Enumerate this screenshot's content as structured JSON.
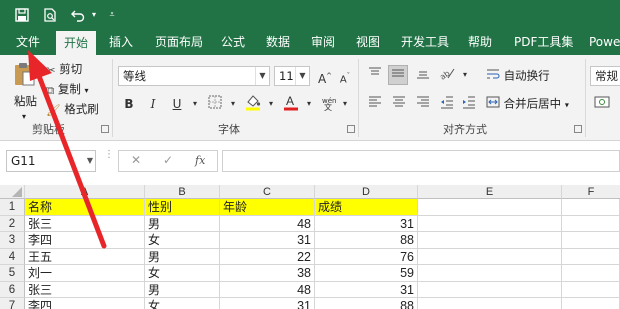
{
  "qat": {
    "icons": [
      "save-icon",
      "print-preview-icon",
      "undo-icon",
      "customize-qat-icon"
    ]
  },
  "tabs": [
    "文件",
    "开始",
    "插入",
    "页面布局",
    "公式",
    "数据",
    "审阅",
    "视图",
    "开发工具",
    "帮助",
    "PDF工具集",
    "Power"
  ],
  "active_tab": "开始",
  "clipboard": {
    "paste": "粘贴",
    "cut": "剪切",
    "copy": "复制",
    "format_painter": "格式刷",
    "group": "剪贴板"
  },
  "font": {
    "name": "等线",
    "size": "11",
    "group": "字体",
    "font_color": "#e02020",
    "fill_color": "#ffff00"
  },
  "alignment": {
    "wrap": "自动换行",
    "merge": "合并后居中",
    "group": "对齐方式"
  },
  "number": {
    "format": "常规"
  },
  "formula_bar": {
    "name_box": "G11",
    "fx": "fx",
    "cancel": "✕",
    "enter": "✓",
    "value": ""
  },
  "columns": [
    "A",
    "B",
    "C",
    "D",
    "E",
    "F"
  ],
  "rows": [
    "1",
    "2",
    "3",
    "4",
    "5",
    "6",
    "7"
  ],
  "table": {
    "header": [
      "名称",
      "性别",
      "年龄",
      "成绩"
    ],
    "rows": [
      [
        "张三",
        "男",
        "48",
        "31"
      ],
      [
        "李四",
        "女",
        "31",
        "88"
      ],
      [
        "王五",
        "男",
        "22",
        "76"
      ],
      [
        "刘一",
        "女",
        "38",
        "59"
      ],
      [
        "张三",
        "男",
        "48",
        "31"
      ],
      [
        "李四",
        "女",
        "31",
        "88"
      ]
    ]
  },
  "colors": {
    "excel_green": "#217346",
    "header_fill": "#ffff00",
    "arrow": "#e8262a"
  }
}
